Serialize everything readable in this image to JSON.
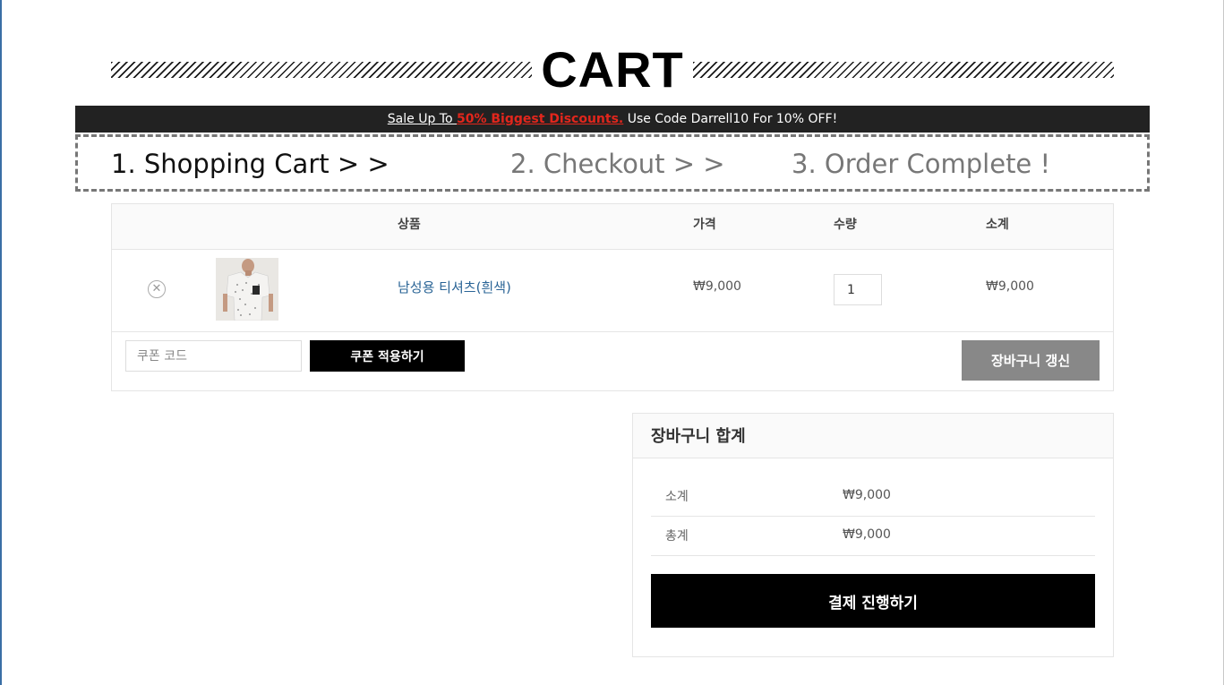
{
  "page": {
    "title": "CART"
  },
  "promo": {
    "prefix": "Sale Up To ",
    "highlight": "50% Biggest Discounts.",
    "suffix": " Use Code Darrell10 For 10% OFF!",
    "highlight_color": "#e2261c"
  },
  "steps": [
    {
      "label": "1. Shopping Cart > >",
      "active": true
    },
    {
      "label": "2. Checkout > >",
      "active": false
    },
    {
      "label": "3. Order Complete !",
      "active": false
    }
  ],
  "cart": {
    "headers": {
      "product": "상품",
      "price": "가격",
      "quantity": "수량",
      "subtotal": "소계"
    },
    "items": [
      {
        "name": "남성용 티셔츠(흰색)",
        "price": "₩9,000",
        "quantity": "1",
        "subtotal": "₩9,000",
        "remove_icon": "remove-circle-icon",
        "image": "t-shirt-thumbnail"
      }
    ],
    "coupon": {
      "placeholder": "쿠폰 코드",
      "value": "",
      "button": "쿠폰 적용하기"
    },
    "update_button": "장바구니 갱신"
  },
  "totals": {
    "title": "장바구니 합계",
    "rows": [
      {
        "label": "소계",
        "value": "₩9,000"
      },
      {
        "label": "총계",
        "value": "₩9,000"
      }
    ],
    "checkout_button": "결제 진행하기"
  },
  "colors": {
    "accent": "#e2261c",
    "link": "#2a6496",
    "dark": "#000000",
    "update_button": "#888888"
  }
}
